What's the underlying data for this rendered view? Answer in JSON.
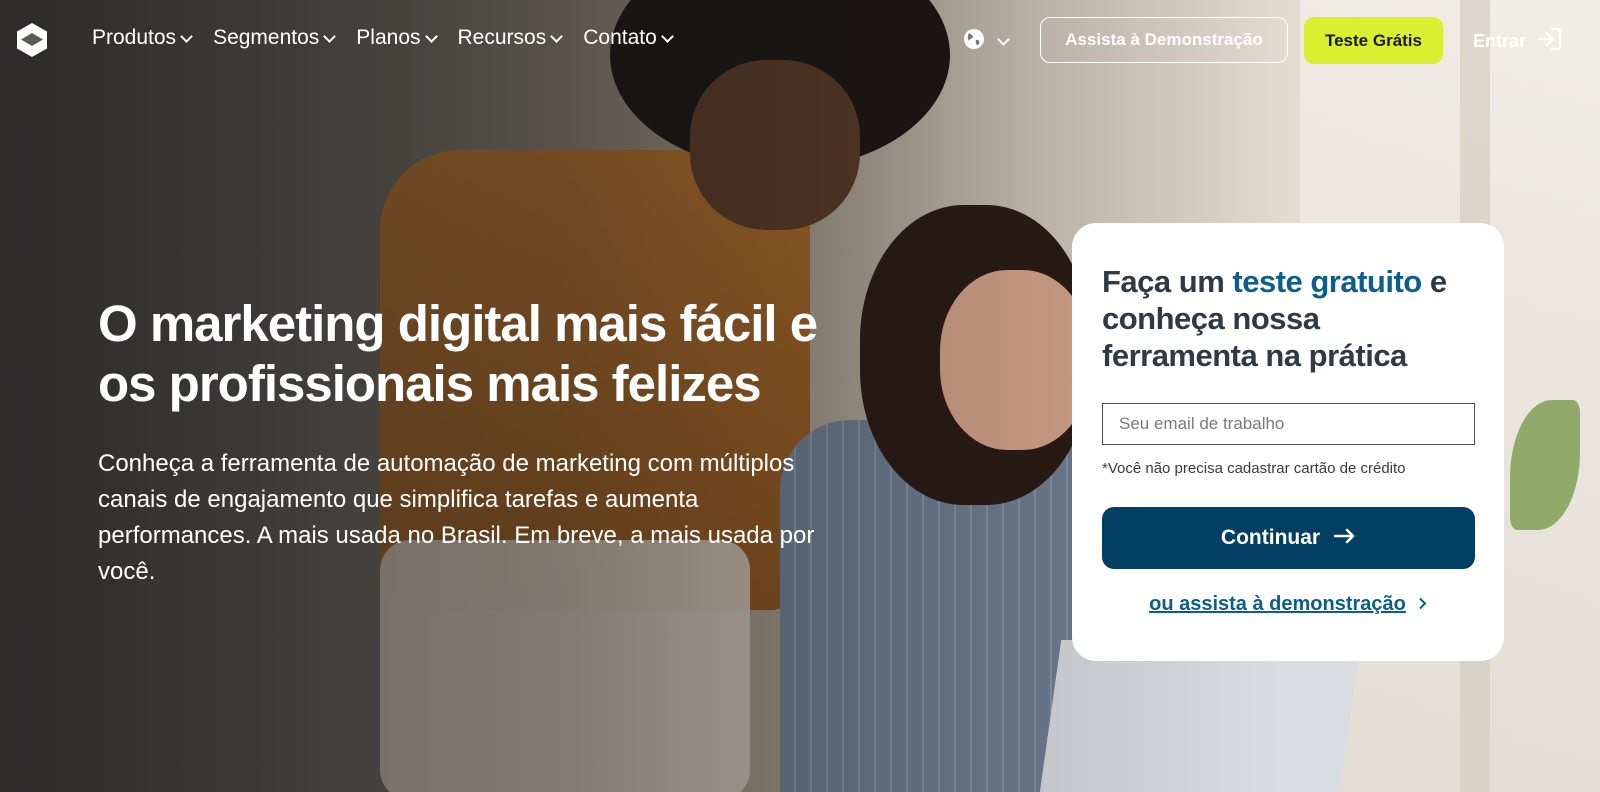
{
  "nav": {
    "items": [
      {
        "label": "Produtos"
      },
      {
        "label": "Segmentos"
      },
      {
        "label": "Planos"
      },
      {
        "label": "Recursos"
      },
      {
        "label": "Contato"
      }
    ],
    "demo_button": "Assista à Demonstração",
    "trial_button": "Teste Grátis",
    "login": "Entrar"
  },
  "hero": {
    "title": "O marketing digital mais fácil e os profissionais mais felizes",
    "subtitle": "Conheça a ferramenta de automação de marketing com múltiplos canais de engajamento que simplifica tarefas e aumenta performances. A mais usada no Brasil. Em breve, a mais usada por você."
  },
  "card": {
    "title_before": "Faça um ",
    "title_highlight": "teste gratuito",
    "title_after": " e conheça nossa ferramenta na prática",
    "email_placeholder": "Seu email de trabalho",
    "note": "*Você não precisa cadastrar cartão de crédito",
    "continue_button": "Continuar",
    "demo_link": "ou assista à demonstração"
  },
  "colors": {
    "accent_lime": "#d8f030",
    "primary_navy": "#033e63",
    "link_blue": "#0b5f8c"
  },
  "icons": {
    "logo": "hexagon-logo",
    "globe": "globe-icon",
    "login": "sign-in-icon",
    "continue": "arrow-right-icon",
    "link": "chevron-right-icon"
  }
}
